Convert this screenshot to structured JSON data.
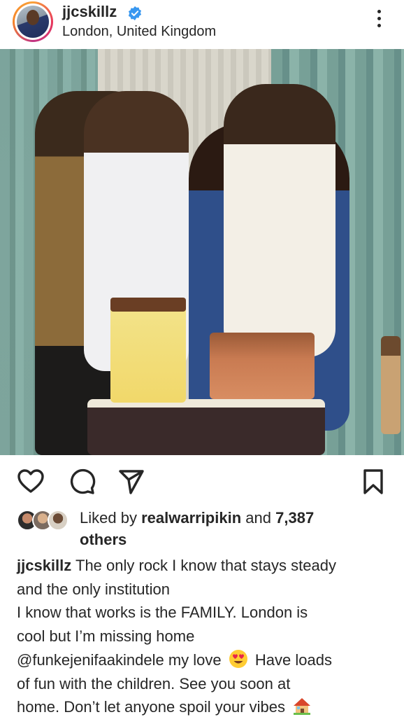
{
  "post": {
    "username": "jjcskillz",
    "location": "London, United Kingdom"
  },
  "icons": {
    "verified": "verified-badge-icon",
    "more": "more-vertical-icon",
    "like": "heart-icon",
    "comment": "comment-icon",
    "share": "send-icon",
    "save": "bookmark-icon"
  },
  "likes": {
    "prefix": "Liked by",
    "user": "realwarripikin",
    "and": "and",
    "count": "7,387",
    "others": "others"
  },
  "caption": {
    "user": "jjcskillz",
    "line1": "The only rock I know that stays steady",
    "line2": "and the only institution",
    "line3": "I know that works is the FAMILY. London is",
    "line4": "cool but I’m missing home",
    "mention": "@funkejenifaakindele",
    "line5_rest": "my love",
    "line5_after": "Have loads",
    "line6": "of fun with the children. See you soon at",
    "line7": "home. Don’t let anyone spoil your vibes"
  },
  "colors": {
    "text": "#262626",
    "verified": "#3897f0"
  }
}
